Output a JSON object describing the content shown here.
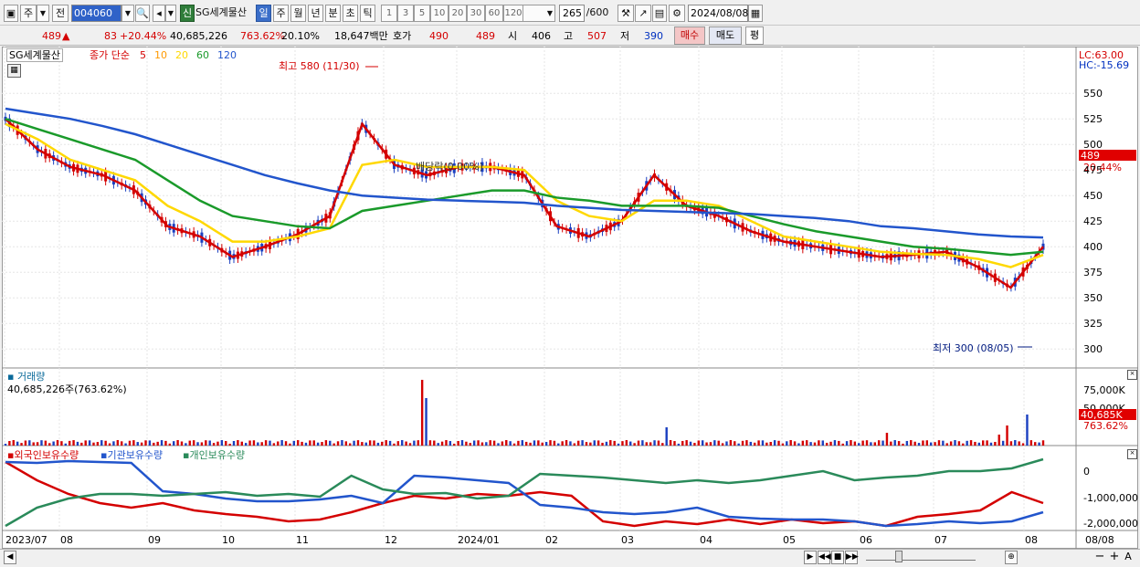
{
  "toolbar": {
    "market_prefix": "주",
    "prev_label": "전",
    "stock_code": "004060",
    "signal_label": "신",
    "stock_name": "SG세계물산",
    "periods": [
      "일",
      "주",
      "월",
      "년",
      "분",
      "초",
      "틱"
    ],
    "selected_period": "일",
    "intervals": [
      "1",
      "3",
      "5",
      "10",
      "20",
      "30",
      "60",
      "120"
    ],
    "count": "265",
    "count_total": "/600",
    "date": "2024/08/08"
  },
  "quote": {
    "price": "489",
    "arrow": "▲",
    "change": "83",
    "change_pct": "+20.44%",
    "volume": "40,685,226",
    "volume_ratio": "763.62%",
    "turnover": "20.10%",
    "amount": "18,647백만",
    "hoga_label": "호가",
    "ask": "490",
    "bid": "489",
    "open_label": "시",
    "open": "406",
    "high_label": "고",
    "high": "507",
    "low_label": "저",
    "low": "390",
    "buy_label": "매수",
    "sell_label": "매도",
    "avg_label": "평"
  },
  "price_panel": {
    "name": "SG세계물산",
    "ma_legend_prefix": "종가 단순",
    "ma_periods": [
      "5",
      "10",
      "20",
      "60",
      "120"
    ],
    "ma_colors": [
      "#d40000",
      "#ff9900",
      "#ffd800",
      "#1a9a2a",
      "#2255cc"
    ],
    "lc": "LC:63.00",
    "hc": "HC:-15.69",
    "last_price_tag": "489",
    "last_pct_tag": "20.44%",
    "high_annotation": "최고 580 (11/30)",
    "low_annotation": "최저 300 (08/05)",
    "dividend_annotation": "배당락(0.00%)",
    "y_ticks": [
      "550",
      "525",
      "500",
      "475",
      "450",
      "425",
      "400",
      "375",
      "350",
      "325",
      "300"
    ]
  },
  "volume_panel": {
    "title": "거래량",
    "value_line": "40,685,226주(763.62%)",
    "y_ticks": [
      "75,000K",
      "50,000K"
    ],
    "last_tag": "40,685K",
    "last_pct": "763.62%"
  },
  "holding_panel": {
    "legend": [
      "외국인보유수량",
      "기관보유수량",
      "개인보유수량"
    ],
    "colors": [
      "#d40000",
      "#2255cc",
      "#2a8a5a"
    ],
    "y_ticks": [
      "0",
      "-1,000,000",
      "-2,000,000"
    ]
  },
  "x_axis": [
    "2023/07",
    "08",
    "09",
    "10",
    "11",
    "12",
    "2024/01",
    "02",
    "03",
    "04",
    "05",
    "06",
    "07",
    "08",
    "08/08"
  ],
  "chart_data": {
    "type": "line",
    "series": [
      {
        "name": "종가 단순 5",
        "values": [
          525,
          495,
          478,
          470,
          455,
          420,
          410,
          390,
          400,
          412,
          430,
          520,
          480,
          470,
          478,
          478,
          470,
          420,
          410,
          425,
          470,
          440,
          430,
          415,
          405,
          400,
          395,
          390,
          392,
          395,
          380,
          360,
          400
        ]
      },
      {
        "name": "20",
        "values": [
          520,
          505,
          485,
          475,
          465,
          440,
          425,
          405,
          405,
          410,
          418,
          480,
          485,
          478,
          478,
          478,
          475,
          445,
          430,
          425,
          445,
          445,
          440,
          425,
          410,
          405,
          400,
          395,
          393,
          392,
          388,
          380,
          392
        ]
      },
      {
        "name": "60",
        "values": [
          525,
          515,
          505,
          495,
          485,
          465,
          445,
          430,
          425,
          420,
          418,
          435,
          440,
          445,
          450,
          455,
          455,
          448,
          445,
          440,
          440,
          440,
          438,
          430,
          422,
          415,
          410,
          405,
          400,
          398,
          395,
          392,
          395
        ]
      },
      {
        "name": "120",
        "values": [
          535,
          530,
          525,
          518,
          510,
          500,
          490,
          480,
          470,
          462,
          455,
          450,
          448,
          446,
          445,
          444,
          443,
          440,
          438,
          436,
          435,
          434,
          433,
          432,
          430,
          428,
          425,
          420,
          418,
          415,
          412,
          410,
          409
        ]
      }
    ]
  }
}
